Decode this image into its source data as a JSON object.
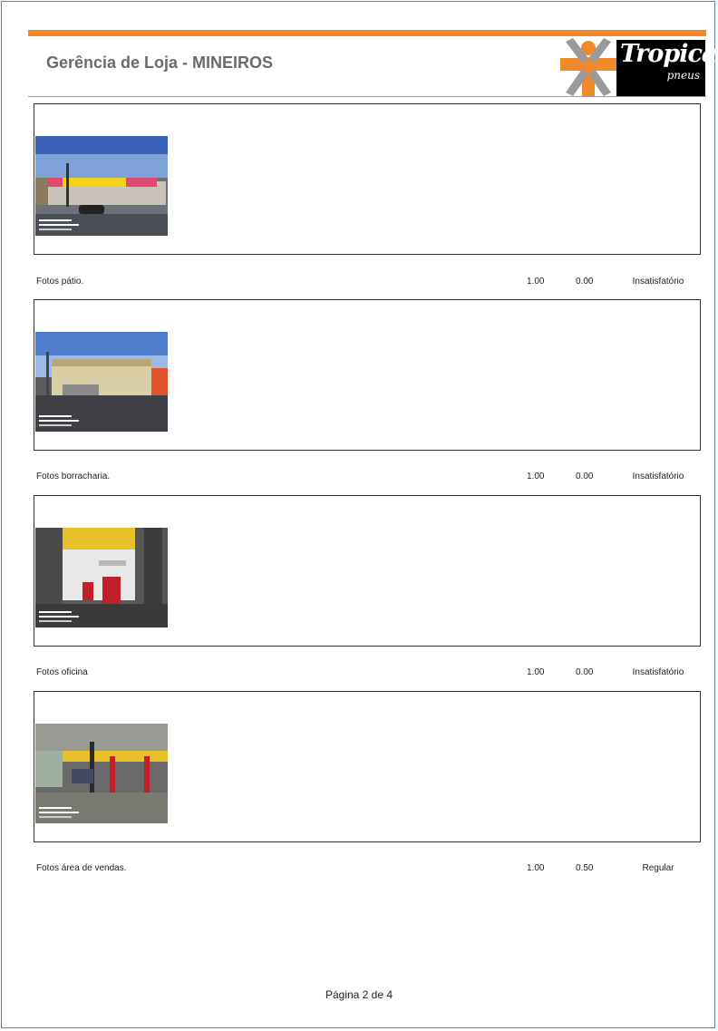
{
  "header": {
    "title": "Gerência de Loja - MINEIROS",
    "logo_text": "Tropical",
    "logo_sub": "pneus",
    "accent_color": "#f0892a"
  },
  "items": [
    {
      "description": "Fotos pátio.",
      "weight": "1.00",
      "score": "0.00",
      "status": "Insatisfatório",
      "photo": "storefront-photo"
    },
    {
      "description": "Fotos borracharia.",
      "weight": "1.00",
      "score": "0.00",
      "status": "Insatisfatório",
      "photo": "tire-shop-photo"
    },
    {
      "description": "Fotos oficina",
      "weight": "1.00",
      "score": "0.00",
      "status": "Insatisfatório",
      "photo": "workshop-photo"
    },
    {
      "description": "Fotos área de vendas.",
      "weight": "1.00",
      "score": "0.50",
      "status": "Regular",
      "photo": "service-bay-photo"
    }
  ],
  "footer": {
    "page_label": "Página 2 de 4"
  }
}
